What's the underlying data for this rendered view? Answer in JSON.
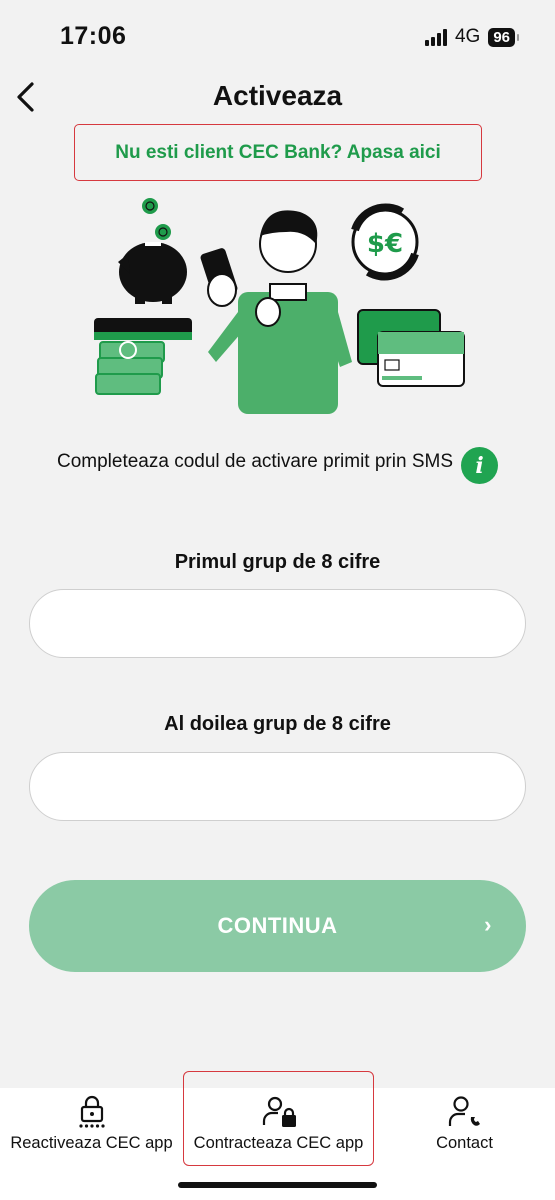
{
  "status_bar": {
    "time": "17:06",
    "network": "4G",
    "battery": "96"
  },
  "header": {
    "title": "Activeaza",
    "not_client_link": "Nu esti client CEC Bank? Apasa aici"
  },
  "illustration": {
    "currency_text": "$€"
  },
  "info": {
    "text": "Completeaza codul de activare primit prin SMS",
    "icon_label": "i"
  },
  "fields": {
    "first": {
      "label": "Primul grup de 8 cifre",
      "value": "",
      "placeholder": ""
    },
    "second": {
      "label": "Al doilea grup de 8 cifre",
      "value": "",
      "placeholder": ""
    }
  },
  "continue_button": {
    "label": "CONTINUA",
    "chevron": "›"
  },
  "bottom_nav": {
    "items": [
      {
        "label": "Reactiveaza CEC app",
        "icon": "lock-reset-icon"
      },
      {
        "label": "Contracteaza CEC app",
        "icon": "user-lock-icon"
      },
      {
        "label": "Contact",
        "icon": "user-phone-icon"
      }
    ]
  },
  "colors": {
    "brand_green": "#20a451",
    "button_disabled": "#8bcaa5",
    "highlight_red": "#d6393f",
    "background": "#f2f2f2"
  }
}
